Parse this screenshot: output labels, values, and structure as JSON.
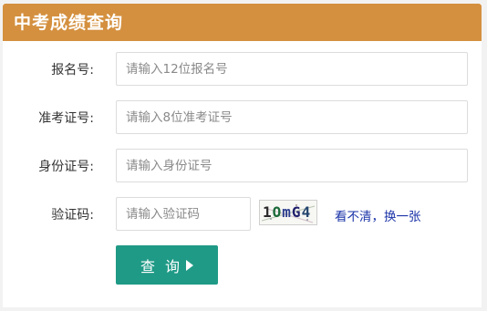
{
  "header": {
    "title": "中考成绩查询"
  },
  "form": {
    "exam_number": {
      "label": "报名号:",
      "placeholder": "请输入12位报名号",
      "value": ""
    },
    "admission_number": {
      "label": "准考证号:",
      "placeholder": "请输入8位准考证号",
      "value": ""
    },
    "id_number": {
      "label": "身份证号:",
      "placeholder": "请输入身份证号",
      "value": ""
    },
    "captcha": {
      "label": "验证码:",
      "placeholder": "请输入验证码",
      "value": "",
      "image_text": "1OmG4"
    },
    "refresh_link": "看不清，换一张",
    "submit_label": "查 询"
  },
  "colors": {
    "header_bg": "#d4903f",
    "button_bg": "#1f9a86",
    "link": "#1a33a8"
  },
  "icons": {
    "submit": "play-arrow-icon"
  }
}
